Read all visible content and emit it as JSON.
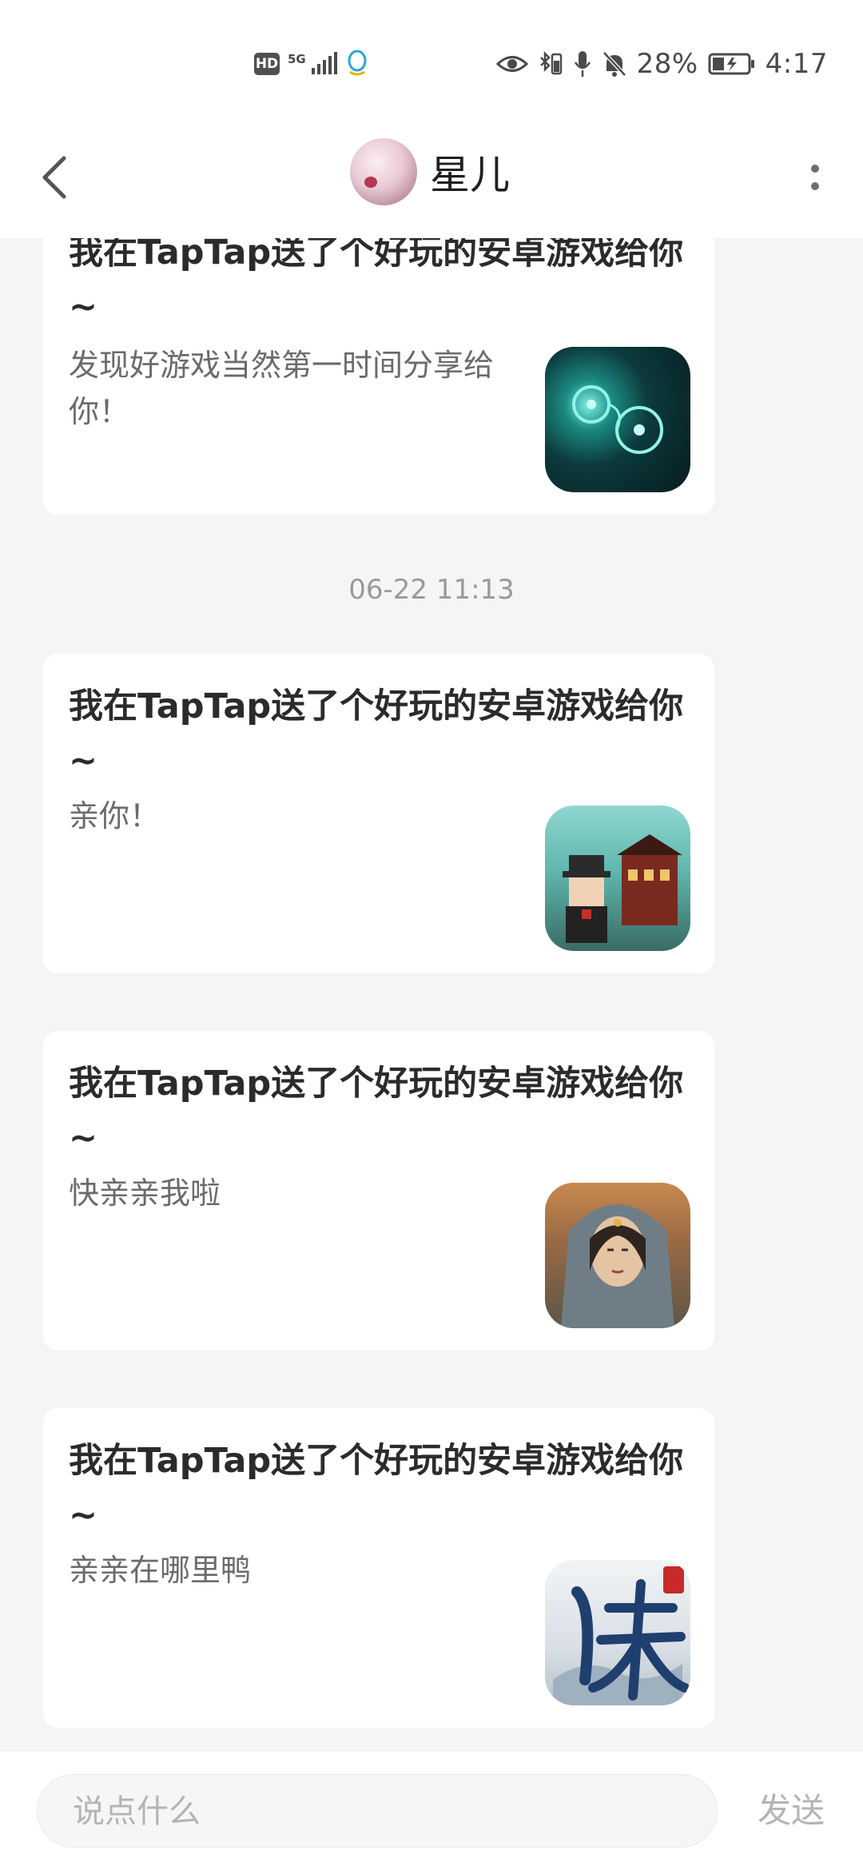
{
  "status_bar": {
    "hd": "HD",
    "network": "5G",
    "battery_percent": "28%",
    "time": "4:17"
  },
  "header": {
    "title": "星儿"
  },
  "messages": [
    {
      "title": "我在TapTap送了个好玩的安卓游戏给你~",
      "desc": "发现好游戏当然第一时间分享给你！"
    },
    {
      "title": "我在TapTap送了个好玩的安卓游戏给你~",
      "desc": "亲你！"
    },
    {
      "title": "我在TapTap送了个好玩的安卓游戏给你~",
      "desc": "快亲亲我啦"
    },
    {
      "title": "我在TapTap送了个好玩的安卓游戏给你~",
      "desc": "亲亲在哪里鸭"
    }
  ],
  "timestamp": "06-22 11:13",
  "input": {
    "placeholder": "说点什么",
    "send_label": "发送"
  }
}
